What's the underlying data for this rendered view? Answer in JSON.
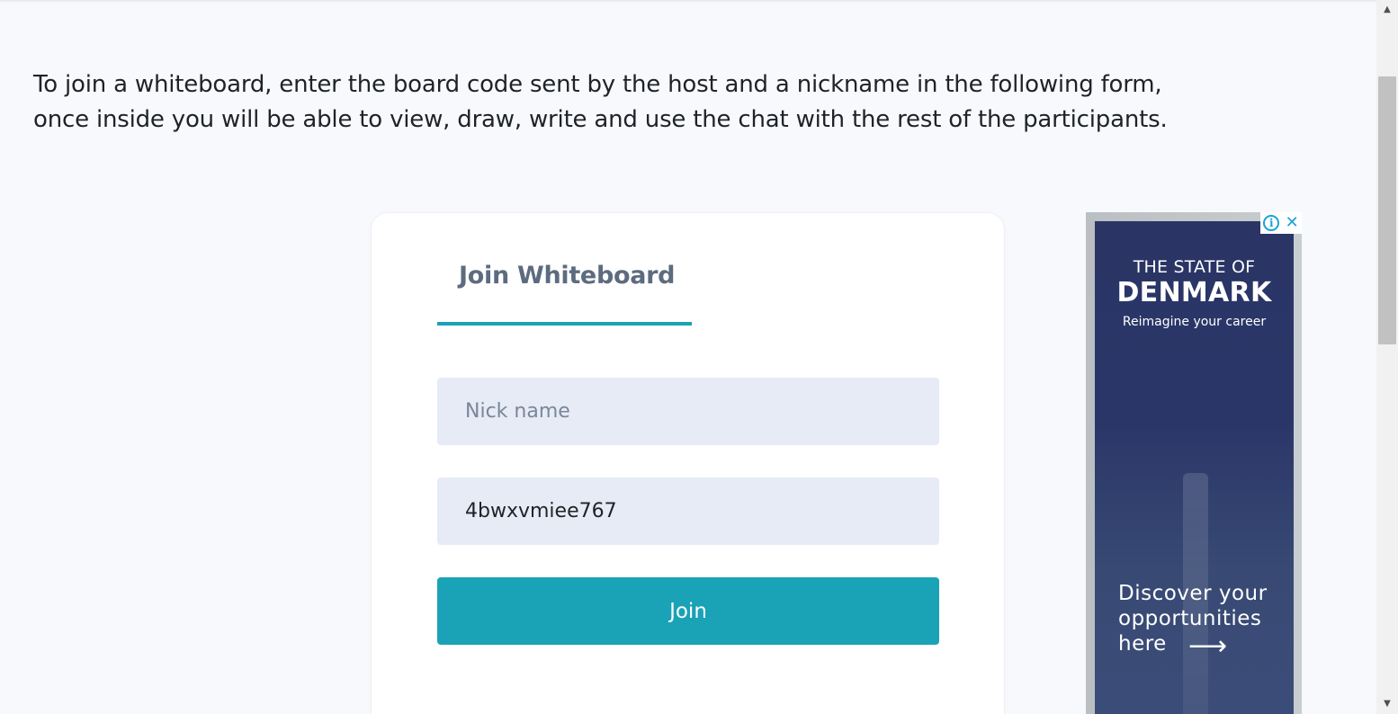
{
  "intro": {
    "line1": "To join a whiteboard, enter the board code sent by the host and a nickname in the following form,",
    "line2": "once inside you will be able to view, draw, write and use the chat with the rest of the participants."
  },
  "form": {
    "tab_label": "Join Whiteboard",
    "nickname_placeholder": "Nick name",
    "nickname_value": "",
    "board_code_value": "4bwxvmiee767",
    "join_label": "Join"
  },
  "ad": {
    "line1": "THE STATE OF",
    "line2": "DENMARK",
    "tagline": "Reimagine your career",
    "cta_line1": "Discover your",
    "cta_line2": "opportunities",
    "cta_line3": "here",
    "arrow": "⟶",
    "info_icon": "i",
    "close_icon": "✕"
  },
  "colors": {
    "accent": "#1aa2b7",
    "input_bg": "#e6ebf5",
    "page_bg": "#f8f9fc"
  },
  "scrollbar": {
    "up_icon": "▲",
    "down_icon": "▼"
  }
}
